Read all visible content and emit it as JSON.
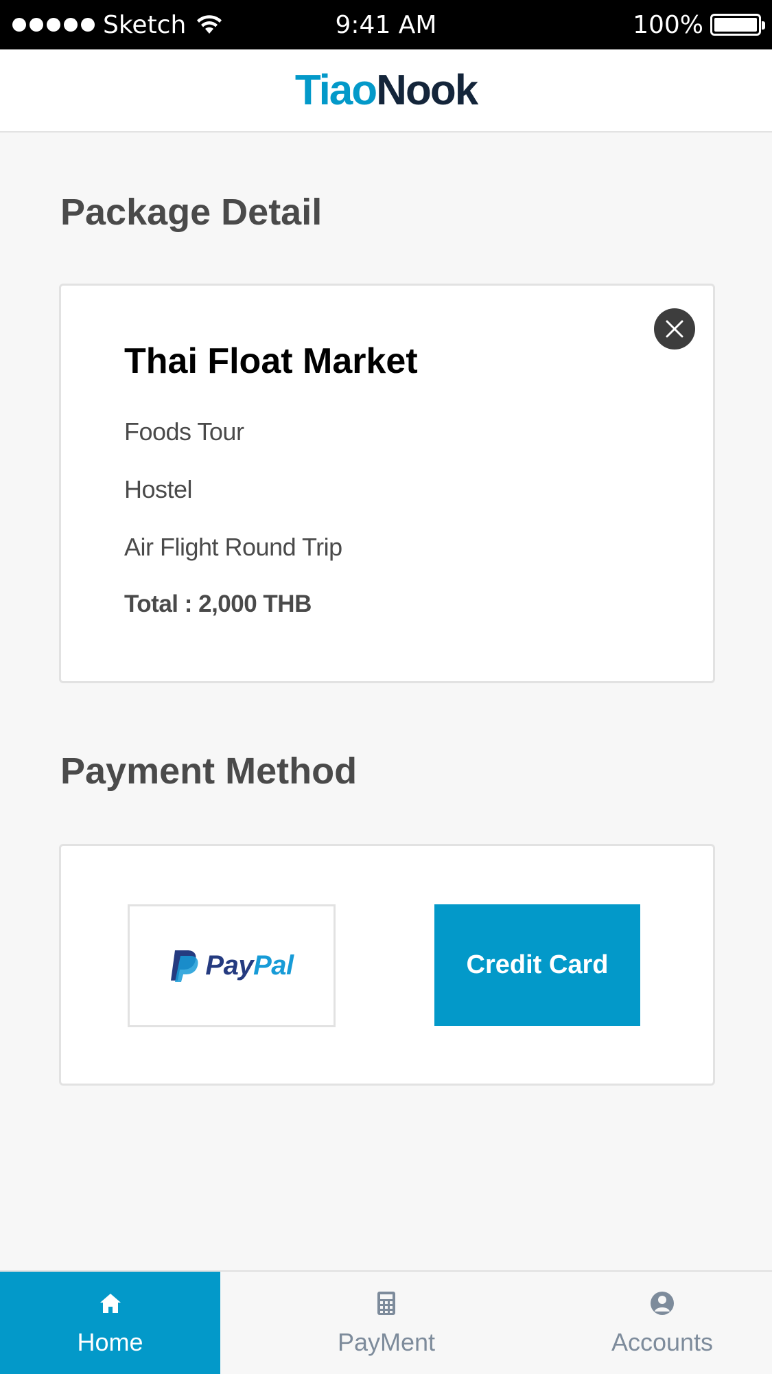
{
  "status_bar": {
    "carrier": "Sketch",
    "time": "9:41 AM",
    "battery": "100%"
  },
  "header": {
    "logo_part1": "Tiao",
    "logo_part2": "Nook"
  },
  "package_section": {
    "title": "Package Detail",
    "card": {
      "name": "Thai Float Market",
      "items": [
        "Foods Tour",
        "Hostel",
        "Air Flight Round Trip"
      ],
      "total": "Total : 2,000 THB"
    }
  },
  "payment_section": {
    "title": "Payment Method",
    "paypal_label_a": "Pay",
    "paypal_label_b": "Pal",
    "credit_card_label": "Credit Card"
  },
  "tabs": [
    {
      "label": "Home",
      "icon": "home-icon",
      "active": true
    },
    {
      "label": "PayMent",
      "icon": "calculator-icon",
      "active": false
    },
    {
      "label": "Accounts",
      "icon": "user-icon",
      "active": false
    }
  ],
  "colors": {
    "accent": "#0399c9",
    "logo_dark": "#14253a",
    "close_button": "#3d3d3d",
    "tab_inactive": "#7d8b9b"
  }
}
